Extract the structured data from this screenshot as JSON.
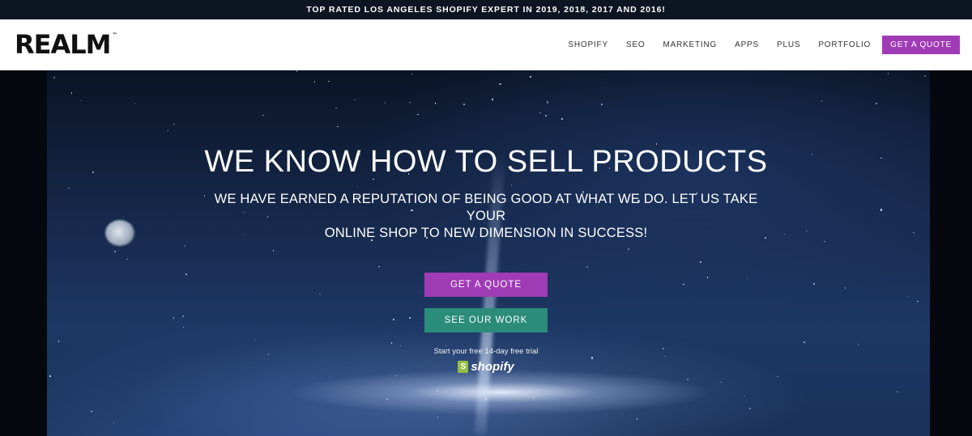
{
  "topbar": {
    "text": "TOP RATED LOS ANGELES SHOPIFY EXPERT IN 2019, 2018, 2017 AND 2016!"
  },
  "header": {
    "logo": "REALM",
    "logo_tm": "™",
    "nav": [
      "SHOPIFY",
      "SEO",
      "MARKETING",
      "APPS",
      "PLUS",
      "PORTFOLIO"
    ],
    "cta": "GET A QUOTE"
  },
  "hero": {
    "title": "WE KNOW HOW TO SELL PRODUCTS",
    "subtitle_line1": "WE HAVE EARNED A REPUTATION OF BEING GOOD AT WHAT WE DO. LET US TAKE YOUR",
    "subtitle_line2": "ONLINE SHOP TO NEW DIMENSION IN SUCCESS!",
    "primary_button": "GET A QUOTE",
    "secondary_button": "SEE OUR WORK",
    "trial_text": "Start your free 14-day free trial",
    "shopify_logo_text": "shopify",
    "shopify_bag_letter": "S"
  },
  "colors": {
    "accent_purple": "#a03bb6",
    "accent_teal": "#2a8c79",
    "shopify_green": "#96bf48"
  },
  "icons": {
    "shopify_logo": "shopify-bag-icon"
  }
}
